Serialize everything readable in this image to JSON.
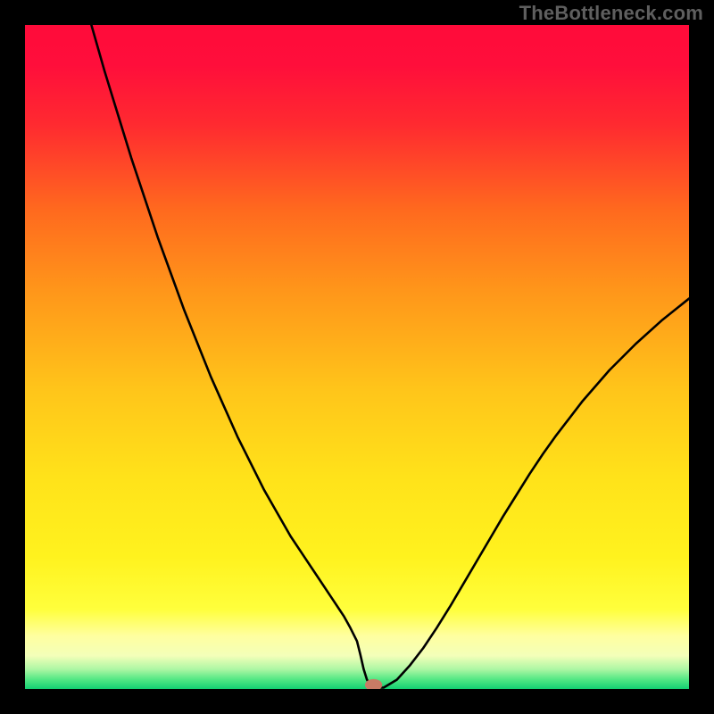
{
  "watermark": "TheBottleneck.com",
  "chart_data": {
    "type": "line",
    "title": "",
    "xlabel": "",
    "ylabel": "",
    "xlim": [
      0,
      100
    ],
    "ylim": [
      0,
      100
    ],
    "gradient_stops": [
      {
        "offset": 0.0,
        "color": "#ff0b3a"
      },
      {
        "offset": 0.06,
        "color": "#ff0e3b"
      },
      {
        "offset": 0.15,
        "color": "#ff2a30"
      },
      {
        "offset": 0.28,
        "color": "#ff6a1e"
      },
      {
        "offset": 0.4,
        "color": "#ff961a"
      },
      {
        "offset": 0.55,
        "color": "#ffc51a"
      },
      {
        "offset": 0.68,
        "color": "#ffe21a"
      },
      {
        "offset": 0.8,
        "color": "#fff21e"
      },
      {
        "offset": 0.88,
        "color": "#ffff3c"
      },
      {
        "offset": 0.92,
        "color": "#ffffa0"
      },
      {
        "offset": 0.95,
        "color": "#f3ffb9"
      },
      {
        "offset": 0.97,
        "color": "#aef7a4"
      },
      {
        "offset": 0.985,
        "color": "#56e885"
      },
      {
        "offset": 1.0,
        "color": "#13cf72"
      }
    ],
    "series": [
      {
        "name": "bottleneck-curve",
        "stroke": "#000000",
        "stroke_width": 2.6,
        "x": [
          10,
          12,
          14,
          16,
          18,
          20,
          22,
          24,
          26,
          28,
          30,
          32,
          34,
          36,
          38,
          40,
          42,
          44,
          46,
          48,
          49,
          50,
          50.5,
          51,
          51.5,
          52,
          53,
          54,
          56,
          58,
          60,
          62,
          64,
          66,
          68,
          70,
          72,
          74,
          76,
          78,
          80,
          84,
          88,
          92,
          96,
          100
        ],
        "y": [
          100,
          93,
          86.5,
          80,
          74,
          68,
          62.5,
          57,
          52,
          47,
          42.5,
          38,
          34,
          30,
          26.5,
          23,
          20,
          17,
          14,
          11,
          9.2,
          7.2,
          5.2,
          3.0,
          1.4,
          0.6,
          0.2,
          0.2,
          1.4,
          3.6,
          6.2,
          9.2,
          12.4,
          15.8,
          19.2,
          22.6,
          26.0,
          29.2,
          32.4,
          35.4,
          38.2,
          43.4,
          48.0,
          52.0,
          55.6,
          58.8
        ]
      }
    ],
    "marker": {
      "name": "optimal-point",
      "x": 52.5,
      "y": 0.6,
      "rx": 1.3,
      "ry": 0.9,
      "fill": "#c97b65"
    }
  }
}
